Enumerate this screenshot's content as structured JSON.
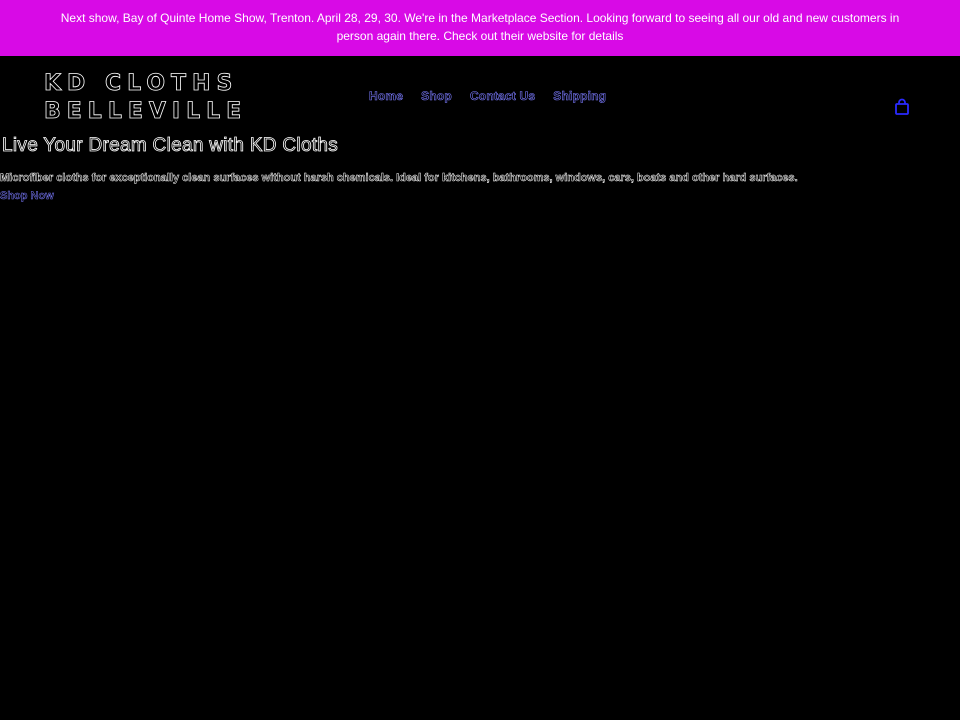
{
  "announcement": {
    "text": "Next show, Bay of Quinte Home Show, Trenton. April 28, 29, 30. We're in the Marketplace Section. Looking forward to seeing all our old and new customers in person again there. Check out their website for details"
  },
  "header": {
    "logo_line1": "KD CLOTHS",
    "logo_line2": "BELLEVILLE",
    "nav": [
      {
        "label": "Home"
      },
      {
        "label": "Shop"
      },
      {
        "label": "Contact Us"
      },
      {
        "label": "Shipping"
      }
    ],
    "cart_icon": "bag-icon"
  },
  "hero": {
    "title": "Live Your Dream Clean with KD Cloths",
    "description": "Microfiber cloths for exceptionally clean surfaces without harsh chemicals. Ideal for kitchens, bathrooms, windows, cars, boats and other hard surfaces.",
    "cta_label": "Shop Now"
  },
  "colors": {
    "announcement_bg": "#d80ae6",
    "page_bg": "#000000",
    "link": "#7b7bff",
    "cart_icon": "#2a2aff"
  }
}
